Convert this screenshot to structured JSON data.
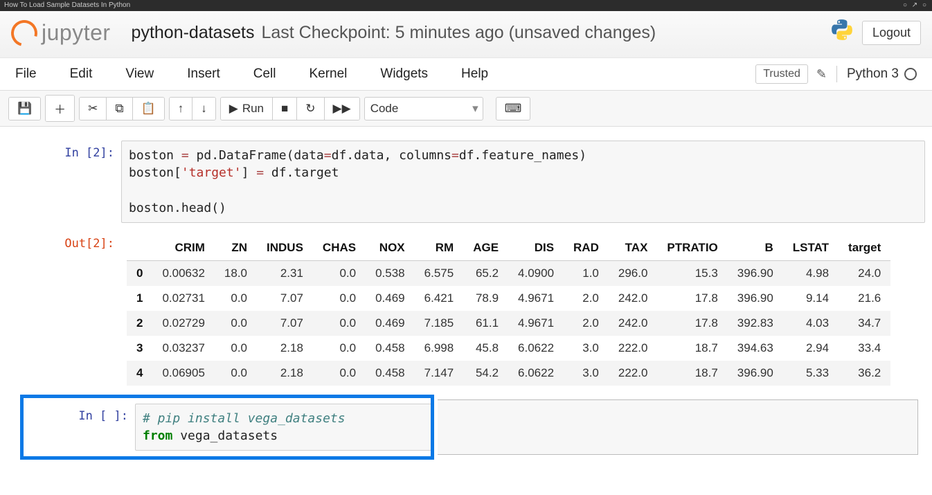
{
  "browser_title": "How To Load Sample Datasets In Python",
  "header": {
    "logo_text": "jupyter",
    "nb_name": "python-datasets",
    "checkpoint": "Last Checkpoint: 5 minutes ago  (unsaved changes)",
    "logout": "Logout"
  },
  "menubar": {
    "items": [
      "File",
      "Edit",
      "View",
      "Insert",
      "Cell",
      "Kernel",
      "Widgets",
      "Help"
    ],
    "trusted": "Trusted",
    "kernel": "Python 3"
  },
  "toolbar": {
    "run_label": "Run",
    "cell_type": "Code"
  },
  "cells": {
    "in2_prompt": "In [2]:",
    "out2_prompt": "Out[2]:",
    "in_blank_prompt": "In [ ]:",
    "code2_l1a": "boston ",
    "code2_l1b": "=",
    "code2_l1c": " pd.DataFrame(data",
    "code2_l1d": "=",
    "code2_l1e": "df.data, columns",
    "code2_l1f": "=",
    "code2_l1g": "df.feature_names)",
    "code2_l2a": "boston[",
    "code2_l2b": "'target'",
    "code2_l2c": "] ",
    "code2_l2d": "=",
    "code2_l2e": " df.target",
    "code2_l3": "",
    "code2_l4": "boston.head()",
    "code3_l1": "# pip install vega_datasets",
    "code3_l2a": "from",
    "code3_l2b": " vega_datasets"
  },
  "chart_data": {
    "type": "table",
    "columns": [
      "CRIM",
      "ZN",
      "INDUS",
      "CHAS",
      "NOX",
      "RM",
      "AGE",
      "DIS",
      "RAD",
      "TAX",
      "PTRATIO",
      "B",
      "LSTAT",
      "target"
    ],
    "index": [
      "0",
      "1",
      "2",
      "3",
      "4"
    ],
    "rows": [
      [
        "0.00632",
        "18.0",
        "2.31",
        "0.0",
        "0.538",
        "6.575",
        "65.2",
        "4.0900",
        "1.0",
        "296.0",
        "15.3",
        "396.90",
        "4.98",
        "24.0"
      ],
      [
        "0.02731",
        "0.0",
        "7.07",
        "0.0",
        "0.469",
        "6.421",
        "78.9",
        "4.9671",
        "2.0",
        "242.0",
        "17.8",
        "396.90",
        "9.14",
        "21.6"
      ],
      [
        "0.02729",
        "0.0",
        "7.07",
        "0.0",
        "0.469",
        "7.185",
        "61.1",
        "4.9671",
        "2.0",
        "242.0",
        "17.8",
        "392.83",
        "4.03",
        "34.7"
      ],
      [
        "0.03237",
        "0.0",
        "2.18",
        "0.0",
        "0.458",
        "6.998",
        "45.8",
        "6.0622",
        "3.0",
        "222.0",
        "18.7",
        "394.63",
        "2.94",
        "33.4"
      ],
      [
        "0.06905",
        "0.0",
        "2.18",
        "0.0",
        "0.458",
        "7.147",
        "54.2",
        "6.0622",
        "3.0",
        "222.0",
        "18.7",
        "396.90",
        "5.33",
        "36.2"
      ]
    ]
  }
}
